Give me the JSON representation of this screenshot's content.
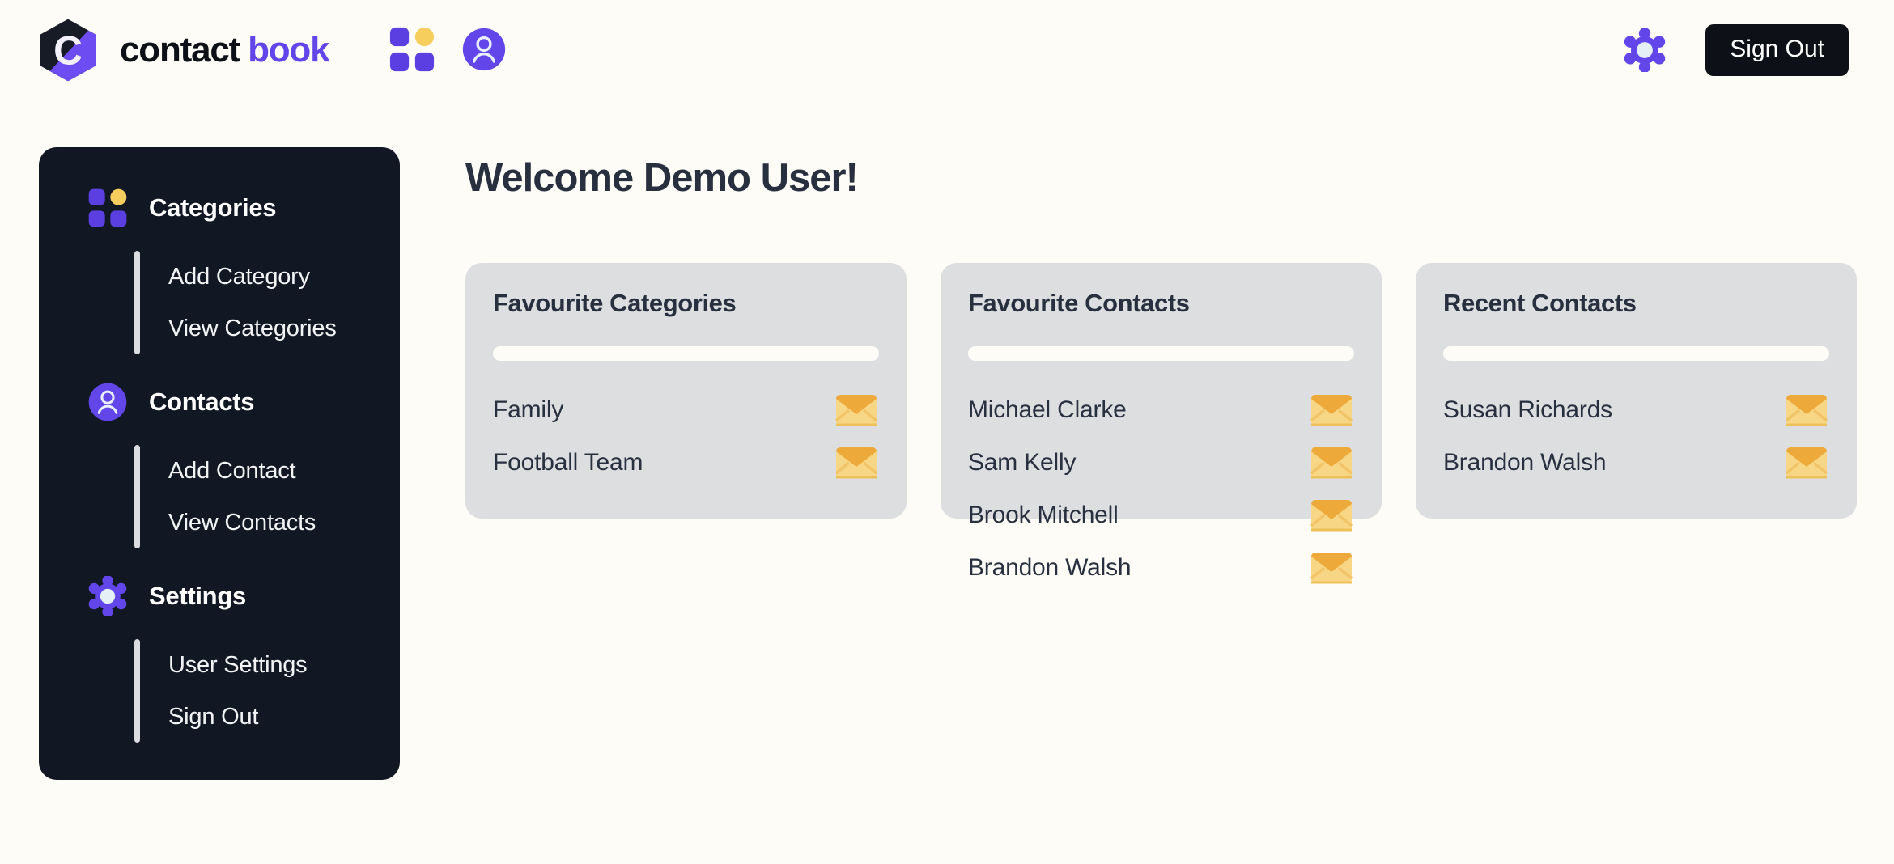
{
  "app": {
    "brand_contact": "contact",
    "brand_book": "book",
    "logo_letter": "C",
    "background_color": "#fdfcf6",
    "accent_purple": "#6246ea",
    "accent_yellow": "#f6ce5e",
    "dark": "#111723",
    "card_bg": "#dddee0",
    "text_dark": "#28303f"
  },
  "header": {
    "grid_icon": "grid-icon",
    "person_icon": "person-icon",
    "gear_icon": "gear-icon",
    "signout_label": "Sign Out"
  },
  "sidebar": {
    "groups": [
      {
        "icon": "grid-icon",
        "label": "Categories",
        "items": [
          {
            "label": "Add Category"
          },
          {
            "label": "View Categories"
          }
        ]
      },
      {
        "icon": "person-icon",
        "label": "Contacts",
        "items": [
          {
            "label": "Add Contact"
          },
          {
            "label": "View Contacts"
          }
        ]
      },
      {
        "icon": "gear-icon",
        "label": "Settings",
        "items": [
          {
            "label": "User Settings"
          },
          {
            "label": "Sign Out"
          }
        ]
      }
    ]
  },
  "main": {
    "page_title": "Welcome Demo User!",
    "cards": [
      {
        "title": "Favourite Categories",
        "rows": [
          {
            "label": "Family",
            "icon": "envelope-icon"
          },
          {
            "label": "Football Team",
            "icon": "envelope-icon"
          }
        ]
      },
      {
        "title": "Favourite Contacts",
        "rows": [
          {
            "label": "Michael Clarke",
            "icon": "envelope-icon"
          },
          {
            "label": "Sam Kelly",
            "icon": "envelope-icon"
          },
          {
            "label": "Brook Mitchell",
            "icon": "envelope-icon"
          },
          {
            "label": "Brandon Walsh",
            "icon": "envelope-icon"
          }
        ]
      },
      {
        "title": "Recent Contacts",
        "rows": [
          {
            "label": "Susan Richards",
            "icon": "envelope-icon"
          },
          {
            "label": "Brandon Walsh",
            "icon": "envelope-icon"
          }
        ]
      }
    ]
  }
}
